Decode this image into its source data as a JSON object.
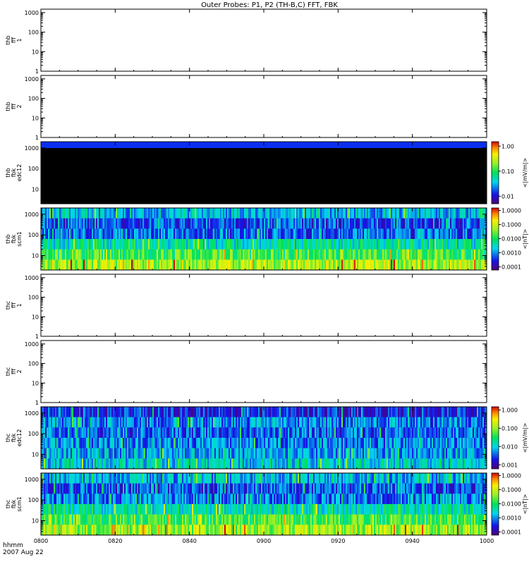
{
  "title": "Outer Probes: P1, P2 (TH-B,C) FFT, FBK",
  "footer": {
    "line1": "hhmm",
    "line2": "2007 Aug 22"
  },
  "xaxis": {
    "ticks": [
      "0800",
      "0820",
      "0840",
      "0900",
      "0920",
      "0940",
      "1000"
    ]
  },
  "colors": {
    "background": "#ffffff",
    "axis": "#000000",
    "dark_fill": "#000000",
    "top_band": "#0a2ff0"
  },
  "chart_data": [
    {
      "type": "heatmap",
      "ylabel": [
        "thb",
        "fff",
        "1"
      ],
      "yscale": "log",
      "ylim": [
        1,
        1500
      ],
      "ytick_values": [
        1,
        10,
        100,
        1000
      ],
      "yticks": [
        "1",
        "10",
        "100",
        "1000"
      ],
      "xlim": [
        "0800",
        "1000"
      ],
      "empty": true
    },
    {
      "type": "heatmap",
      "ylabel": [
        "thb",
        "fff",
        "2"
      ],
      "yscale": "log",
      "ylim": [
        1,
        1500
      ],
      "ytick_values": [
        1,
        10,
        100,
        1000
      ],
      "yticks": [
        "1",
        "10",
        "100",
        "1000"
      ],
      "xlim": [
        "0800",
        "1000"
      ],
      "empty": true
    },
    {
      "type": "heatmap",
      "ylabel": [
        "thb",
        "fbk",
        "edc12"
      ],
      "yscale": "log",
      "ylim": [
        2,
        2000
      ],
      "ytick_values": [
        10,
        100,
        1000
      ],
      "yticks": [
        "10",
        "100",
        "1000"
      ],
      "xlim": [
        "0800",
        "1000"
      ],
      "mode": "dark",
      "colorbar": {
        "label": "<|mV/m|>",
        "ticks": [
          "1.00",
          "0.10",
          "0.01"
        ],
        "tick_values": [
          1.0,
          0.1,
          0.01
        ],
        "range": [
          0.005,
          1.5
        ]
      }
    },
    {
      "type": "heatmap",
      "ylabel": [
        "thb",
        "fbk",
        "scm1"
      ],
      "yscale": "log",
      "ylim": [
        2,
        2000
      ],
      "ytick_values": [
        10,
        100,
        1000
      ],
      "yticks": [
        "10",
        "100",
        "1000"
      ],
      "xlim": [
        "0800",
        "1000"
      ],
      "mode": "bands",
      "bands": [
        {
          "name": "2689 Hz",
          "level": 0.32
        },
        {
          "name": "572 Hz",
          "level": 0.2
        },
        {
          "name": "144 Hz",
          "level": 0.22
        },
        {
          "name": "36 Hz",
          "level": 0.42
        },
        {
          "name": "9 Hz",
          "level": 0.55
        },
        {
          "name": "2 Hz",
          "level": 0.68
        }
      ],
      "colorbar": {
        "label": "<|nT|>",
        "ticks": [
          "1.0000",
          "0.1000",
          "0.0100",
          "0.0010",
          "0.0001"
        ],
        "tick_values": [
          1.0,
          0.1,
          0.01,
          0.001,
          0.0001
        ],
        "range": [
          6e-05,
          1.5
        ]
      }
    },
    {
      "type": "heatmap",
      "ylabel": [
        "thc",
        "fff",
        "1"
      ],
      "yscale": "log",
      "ylim": [
        1,
        1500
      ],
      "ytick_values": [
        1,
        10,
        100,
        1000
      ],
      "yticks": [
        "1",
        "10",
        "100",
        "1000"
      ],
      "xlim": [
        "0800",
        "1000"
      ],
      "empty": true
    },
    {
      "type": "heatmap",
      "ylabel": [
        "thc",
        "fff",
        "2"
      ],
      "yscale": "log",
      "ylim": [
        1,
        1500
      ],
      "ytick_values": [
        1,
        10,
        100,
        1000
      ],
      "yticks": [
        "1",
        "10",
        "100",
        "1000"
      ],
      "xlim": [
        "0800",
        "1000"
      ],
      "empty": true
    },
    {
      "type": "heatmap",
      "ylabel": [
        "thc",
        "fbk",
        "edc12"
      ],
      "yscale": "log",
      "ylim": [
        2,
        2000
      ],
      "ytick_values": [
        10,
        100,
        1000
      ],
      "yticks": [
        "10",
        "100",
        "1000"
      ],
      "xlim": [
        "0800",
        "1000"
      ],
      "mode": "bands",
      "bands": [
        {
          "name": "2689 Hz",
          "level": 0.16
        },
        {
          "name": "572 Hz",
          "level": 0.26
        },
        {
          "name": "144 Hz",
          "level": 0.22
        },
        {
          "name": "36 Hz",
          "level": 0.26
        },
        {
          "name": "9 Hz",
          "level": 0.3
        },
        {
          "name": "2 Hz",
          "level": 0.36
        }
      ],
      "colorbar": {
        "label": "<|mV/m|>",
        "ticks": [
          "1.000",
          "0.100",
          "0.010",
          "0.001"
        ],
        "tick_values": [
          1.0,
          0.1,
          0.01,
          0.001
        ],
        "range": [
          0.0006,
          1.5
        ]
      }
    },
    {
      "type": "heatmap",
      "ylabel": [
        "thc",
        "fbk",
        "scm1"
      ],
      "yscale": "log",
      "ylim": [
        2,
        2000
      ],
      "ytick_values": [
        10,
        100,
        1000
      ],
      "yticks": [
        "10",
        "100",
        "1000"
      ],
      "xlim": [
        "0800",
        "1000"
      ],
      "mode": "bands",
      "bands": [
        {
          "name": "2689 Hz",
          "level": 0.32
        },
        {
          "name": "572 Hz",
          "level": 0.2
        },
        {
          "name": "144 Hz",
          "level": 0.24
        },
        {
          "name": "36 Hz",
          "level": 0.42
        },
        {
          "name": "9 Hz",
          "level": 0.55
        },
        {
          "name": "2 Hz",
          "level": 0.66
        }
      ],
      "colorbar": {
        "label": "<|nT|>",
        "ticks": [
          "1.0000",
          "0.1000",
          "0.0100",
          "0.0010",
          "0.0001"
        ],
        "tick_values": [
          1.0,
          0.1,
          0.01,
          0.001,
          0.0001
        ],
        "range": [
          6e-05,
          1.5
        ]
      }
    }
  ]
}
